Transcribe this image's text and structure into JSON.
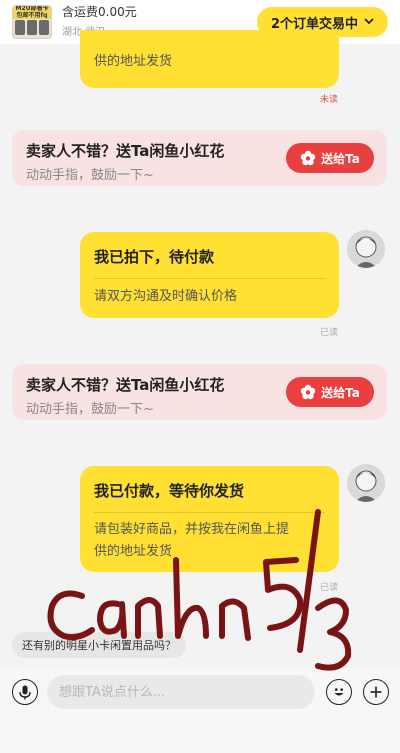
{
  "header": {
    "thumbnail_text": "M2U部署卡 包邮不用fq",
    "shipping_fee": "含运费0.00元",
    "location": "湖北·武汉",
    "order_button": "2个订单交易中",
    "chevron_icon": "chevron-down-icon"
  },
  "messages": {
    "top_partial": {
      "desc": "供的地址发货",
      "status": "未读"
    },
    "flower_card_1": {
      "title": "卖家人不错？送Ta闲鱼小红花",
      "subtitle": "动动手指，鼓励一下~",
      "button": "送给Ta"
    },
    "order_placed": {
      "title": "我已拍下，待付款",
      "desc": "请双方沟通及时确认价格",
      "status": "已读"
    },
    "flower_card_2": {
      "title": "卖家人不错？送Ta闲鱼小红花",
      "subtitle": "动动手指，鼓励一下~",
      "button": "送给Ta"
    },
    "paid": {
      "title": "我已付款，等待你发货",
      "desc_line1": "请包装好商品，并按我在闲鱼上提",
      "desc_line2": "供的地址发货",
      "status": "已读"
    }
  },
  "suggestion": "还有别的明星小卡闲置用品吗？",
  "input": {
    "placeholder": "想跟TA说点什么..."
  },
  "handwriting": "canhn 5/3",
  "colors": {
    "accent_yellow": "#ffe033",
    "send_red": "#ea3f3f",
    "flower_card_bg": "#f9e2e2",
    "scribble": "#7a1414"
  }
}
